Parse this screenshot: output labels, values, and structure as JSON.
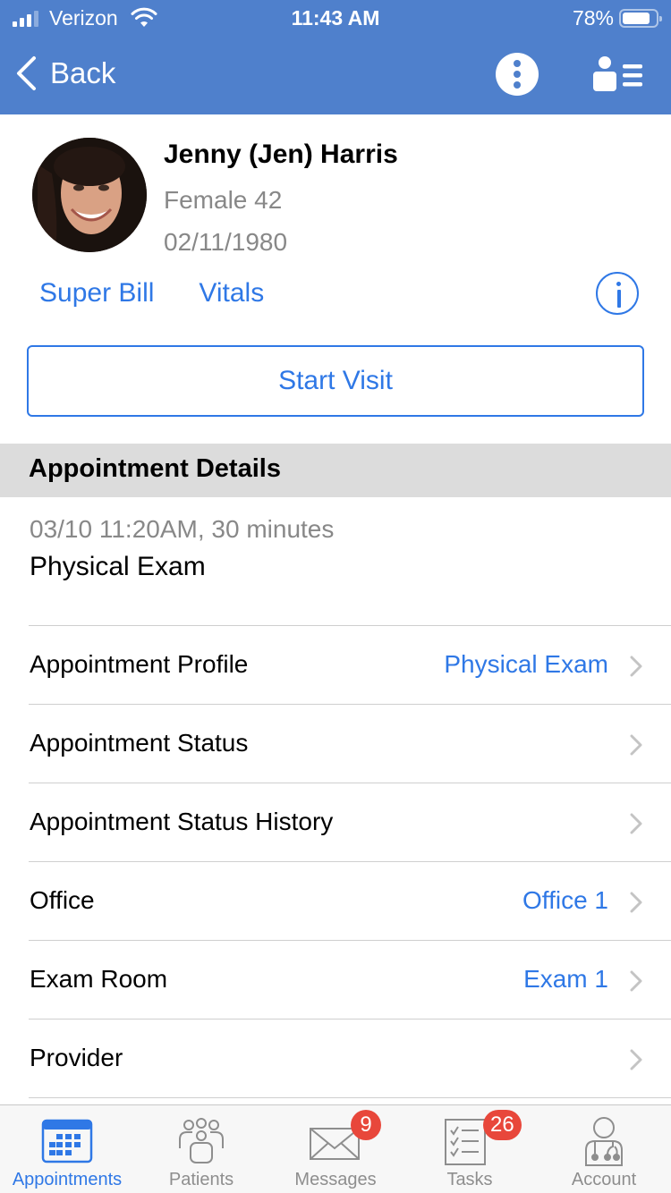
{
  "status_bar": {
    "carrier": "Verizon",
    "time": "11:43 AM",
    "battery_percent": "78%",
    "battery_level": 0.78,
    "signal_bars": 3
  },
  "nav": {
    "back_label": "Back",
    "more_icon": "vertical-ellipsis-icon",
    "patient_list_icon": "person-list-icon"
  },
  "patient": {
    "name": "Jenny (Jen) Harris",
    "sex_age": "Female 42",
    "dob": "02/11/1980",
    "links": [
      "Super Bill",
      "Vitals"
    ],
    "info_icon": "info-icon",
    "start_visit_label": "Start Visit"
  },
  "appointment": {
    "section_title": "Appointment Details",
    "when": "03/10 11:20AM, 30 minutes",
    "type": "Physical Exam",
    "rows": [
      {
        "label": "Appointment Profile",
        "value": "Physical Exam"
      },
      {
        "label": "Appointment Status",
        "value": ""
      },
      {
        "label": "Appointment Status History",
        "value": ""
      },
      {
        "label": "Office",
        "value": "Office 1"
      },
      {
        "label": "Exam Room",
        "value": "Exam 1"
      },
      {
        "label": "Provider",
        "value": ""
      }
    ]
  },
  "tabbar": {
    "tabs": [
      {
        "label": "Appointments",
        "icon": "calendar-icon",
        "active": true,
        "badge": ""
      },
      {
        "label": "Patients",
        "icon": "patients-group-icon",
        "active": false,
        "badge": ""
      },
      {
        "label": "Messages",
        "icon": "envelope-icon",
        "active": false,
        "badge": "9"
      },
      {
        "label": "Tasks",
        "icon": "checklist-icon",
        "active": false,
        "badge": "26"
      },
      {
        "label": "Account",
        "icon": "doctor-icon",
        "active": false,
        "badge": ""
      }
    ]
  },
  "colors": {
    "nav_blue": "#4f80cc",
    "link_blue": "#2f78e6",
    "badge_red": "#e8473b",
    "section_gray": "#dcdcdc",
    "secondary_text": "#888888"
  }
}
